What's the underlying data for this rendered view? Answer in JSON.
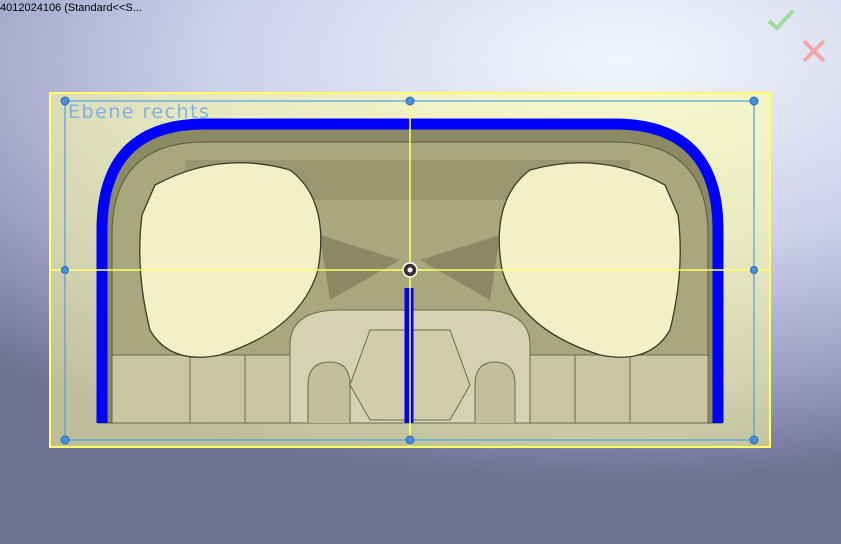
{
  "window": {
    "title": "4012024106  (Standard<<S..."
  },
  "confirm": {
    "ok_icon": "check-icon",
    "cancel_icon": "close-icon",
    "ok_color": "#9fdc9b",
    "cancel_color": "#f0a8a8"
  },
  "sketch": {
    "plane_label": "Ebene rechts",
    "sketch_color": "#0000ff",
    "plane_color": "#ffff80"
  }
}
